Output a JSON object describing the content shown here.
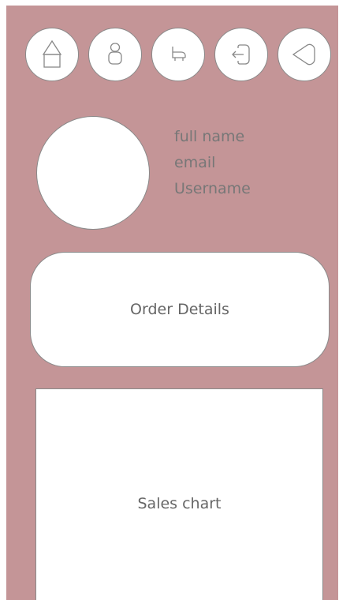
{
  "nav": {
    "items": [
      {
        "icon": "home-icon"
      },
      {
        "icon": "user-icon"
      },
      {
        "icon": "cart-icon"
      },
      {
        "icon": "logout-icon"
      },
      {
        "icon": "back-icon"
      }
    ]
  },
  "profile": {
    "full_name": "full name",
    "email": "email",
    "username": "Username"
  },
  "order_card": {
    "label": "Order Details"
  },
  "sales_chart": {
    "label": "Sales chart"
  },
  "colors": {
    "background": "#c49597",
    "card": "#ffffff",
    "border": "#8a8a8a",
    "text": "#777777"
  }
}
